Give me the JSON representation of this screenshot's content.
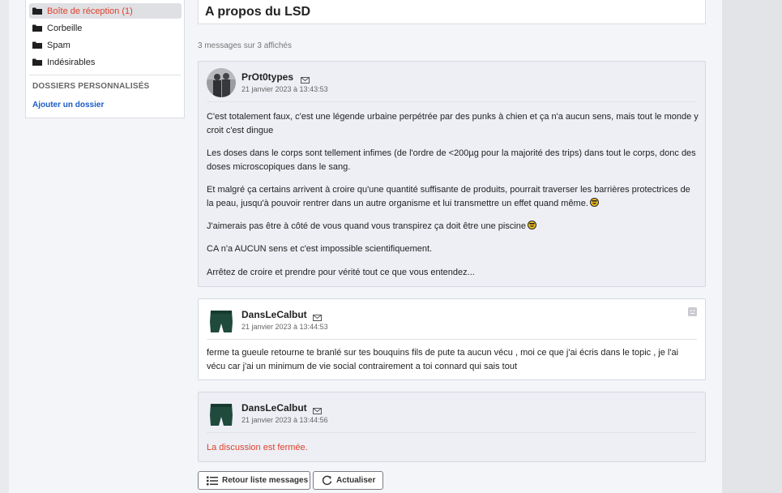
{
  "sidebar": {
    "folders": [
      {
        "label": "Boîte de réception (1)",
        "icon": "folder-icon",
        "active": true
      },
      {
        "label": "Corbeille",
        "icon": "folder-icon"
      },
      {
        "label": "Spam",
        "icon": "folder-icon"
      },
      {
        "label": "Indésirables",
        "icon": "folder-icon"
      }
    ],
    "custom_section_title": "DOSSIERS PERSONNALISÉS",
    "add_folder_label": "Ajouter un dossier"
  },
  "thread": {
    "title": "A propos du LSD",
    "message_count": "3 messages sur 3 affichés"
  },
  "messages": [
    {
      "author": "PrOt0types",
      "date": "21 janvier 2023 à 13:43:53",
      "paragraphs": [
        "C'est totalement faux, c'est une légende urbaine perpétrée par des punks à chien et ça n'a aucun sens, mais tout le monde y croit c'est dingue",
        "Les doses dans le corps sont tellement infimes (de l'ordre de <200µg pour la majorité des trips) dans tout le corps, donc des doses microscopiques dans le sang.",
        "Et malgré ça certains arrivent à croire qu'une quantité suffisante de produits, pourrait traverser les barrières protectrices de la peau, jusqu'à pouvoir rentrer dans un autre organisme et lui transmettre un effet quand même.",
        "J'aimerais pas être à côté de vous quand vous transpirez ça doit être une piscine",
        "CA n'a AUCUN sens et c'est impossible scientifiquement.",
        "Arrêtez de croire et prendre pour vérité tout ce que vous entendez..."
      ]
    },
    {
      "author": "DansLeCalbut",
      "date": "21 janvier 2023 à 13:44:53",
      "paragraphs": [
        "ferme ta gueule retourne te branlé sur tes bouquins fils de pute ta aucun vécu , moi ce que j'ai écris dans le topic , je l'ai vécu car j'ai un minimum de vie social contrairement a toi connard qui sais tout"
      ]
    },
    {
      "author": "DansLeCalbut",
      "date": "21 janvier 2023 à 13:44:56",
      "status": "La discussion est fermée."
    }
  ],
  "actions": {
    "back_label": "Retour liste messages",
    "refresh_label": "Actualiser"
  },
  "colors": {
    "accent_red": "#e0402a",
    "link_blue": "#1a5bc4"
  }
}
